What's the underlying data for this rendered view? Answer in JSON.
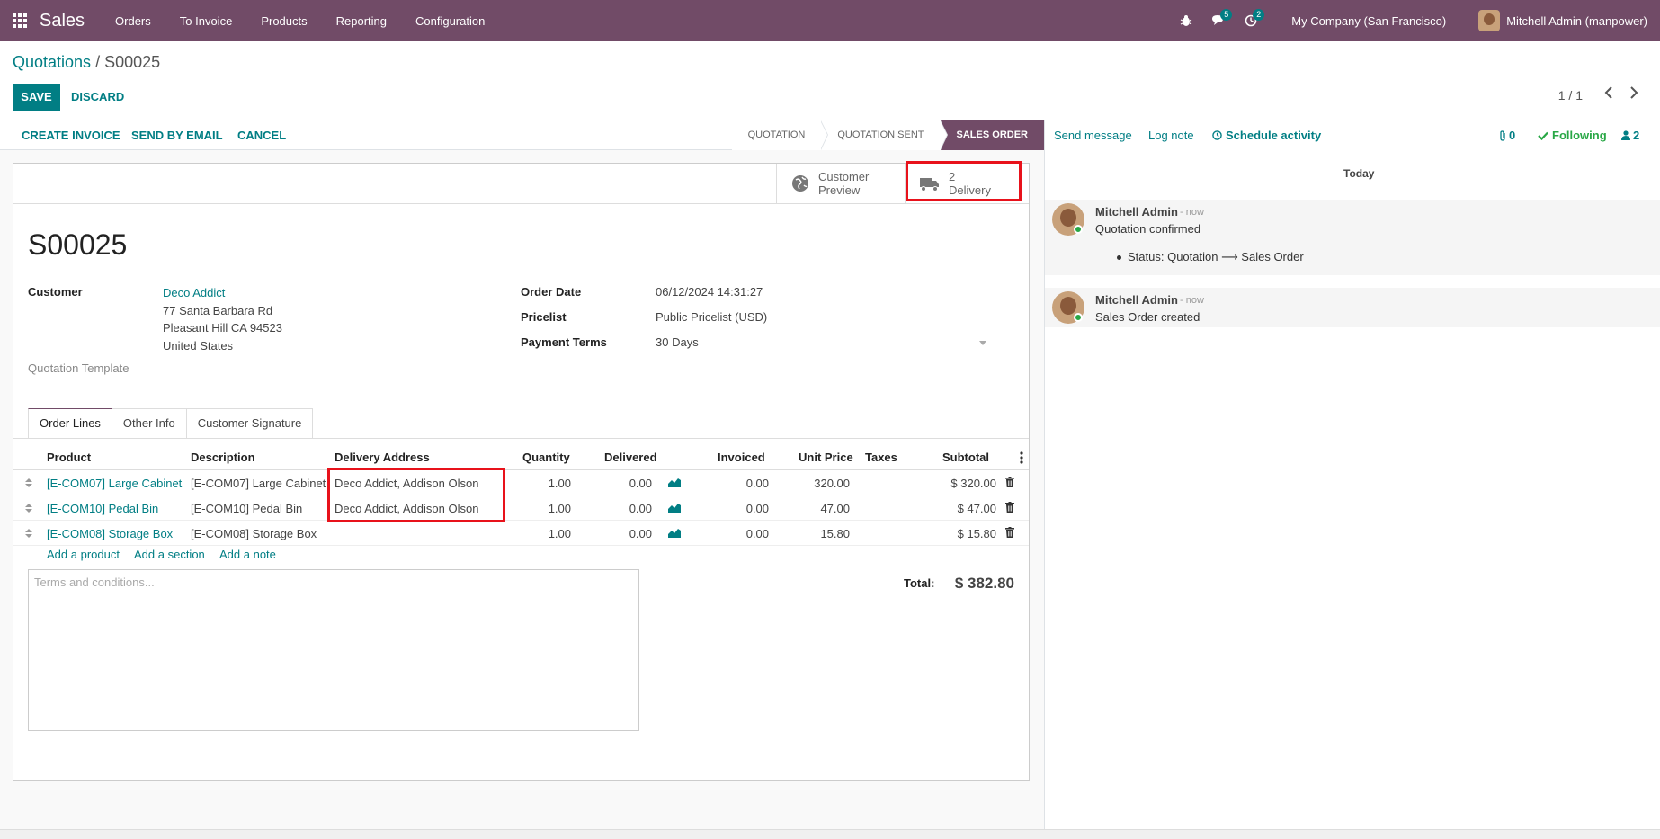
{
  "navbar": {
    "app_name": "Sales",
    "menu": [
      "Orders",
      "To Invoice",
      "Products",
      "Reporting",
      "Configuration"
    ],
    "messages_badge": "5",
    "activities_badge": "2",
    "company": "My Company (San Francisco)",
    "user": "Mitchell Admin (manpower)"
  },
  "control_panel": {
    "breadcrumb_parent": "Quotations",
    "breadcrumb_sep": "/",
    "breadcrumb_current": "S00025",
    "save_label": "SAVE",
    "discard_label": "DISCARD",
    "pager": "1 / 1"
  },
  "statusbar": {
    "buttons": [
      "CREATE INVOICE",
      "SEND BY EMAIL",
      "CANCEL"
    ],
    "stages": [
      "QUOTATION",
      "QUOTATION SENT",
      "SALES ORDER"
    ],
    "active_stage": "SALES ORDER"
  },
  "smart_buttons": {
    "preview_line1": "Customer",
    "preview_line2": "Preview",
    "delivery_count": "2",
    "delivery_label": "Delivery"
  },
  "record": {
    "name": "S00025",
    "customer_label": "Customer",
    "customer_name": "Deco Addict",
    "customer_address": [
      "77 Santa Barbara Rd",
      "Pleasant Hill CA 94523",
      "United States"
    ],
    "quotation_template_label": "Quotation Template",
    "order_date_label": "Order Date",
    "order_date": "06/12/2024 14:31:27",
    "pricelist_label": "Pricelist",
    "pricelist": "Public Pricelist (USD)",
    "payment_terms_label": "Payment Terms",
    "payment_terms": "30 Days"
  },
  "tabs": [
    "Order Lines",
    "Other Info",
    "Customer Signature"
  ],
  "order_lines": {
    "columns": [
      "Product",
      "Description",
      "Delivery Address",
      "Quantity",
      "Delivered",
      "Invoiced",
      "Unit Price",
      "Taxes",
      "Subtotal"
    ],
    "rows": [
      {
        "product": "[E-COM07] Large Cabinet",
        "description": "[E-COM07] Large Cabinet",
        "delivery_address": "Deco Addict, Addison Olson",
        "quantity": "1.00",
        "delivered": "0.00",
        "invoiced": "0.00",
        "unit_price": "320.00",
        "taxes": "",
        "subtotal": "$ 320.00"
      },
      {
        "product": "[E-COM10] Pedal Bin",
        "description": "[E-COM10] Pedal Bin",
        "delivery_address": "Deco Addict, Addison Olson",
        "quantity": "1.00",
        "delivered": "0.00",
        "invoiced": "0.00",
        "unit_price": "47.00",
        "taxes": "",
        "subtotal": "$ 47.00"
      },
      {
        "product": "[E-COM08] Storage Box",
        "description": "[E-COM08] Storage Box",
        "delivery_address": "",
        "quantity": "1.00",
        "delivered": "0.00",
        "invoiced": "0.00",
        "unit_price": "15.80",
        "taxes": "",
        "subtotal": "$ 15.80"
      }
    ],
    "add_product": "Add a product",
    "add_section": "Add a section",
    "add_note": "Add a note"
  },
  "terms_placeholder": "Terms and conditions...",
  "total": {
    "label": "Total:",
    "value": "$ 382.80"
  },
  "chatter": {
    "send_message": "Send message",
    "log_note": "Log note",
    "schedule_activity": "Schedule activity",
    "attachments_count": "0",
    "following": "Following",
    "followers_count": "2",
    "today": "Today",
    "messages": [
      {
        "author": "Mitchell Admin",
        "time": "- now",
        "body": "Quotation confirmed",
        "detail": "Status: Quotation ⟶ Sales Order"
      },
      {
        "author": "Mitchell Admin",
        "time": "- now",
        "body": "Sales Order created"
      }
    ]
  },
  "colors": {
    "brand": "#714b67",
    "accent": "#017e84",
    "highlight": "#e8121b"
  }
}
